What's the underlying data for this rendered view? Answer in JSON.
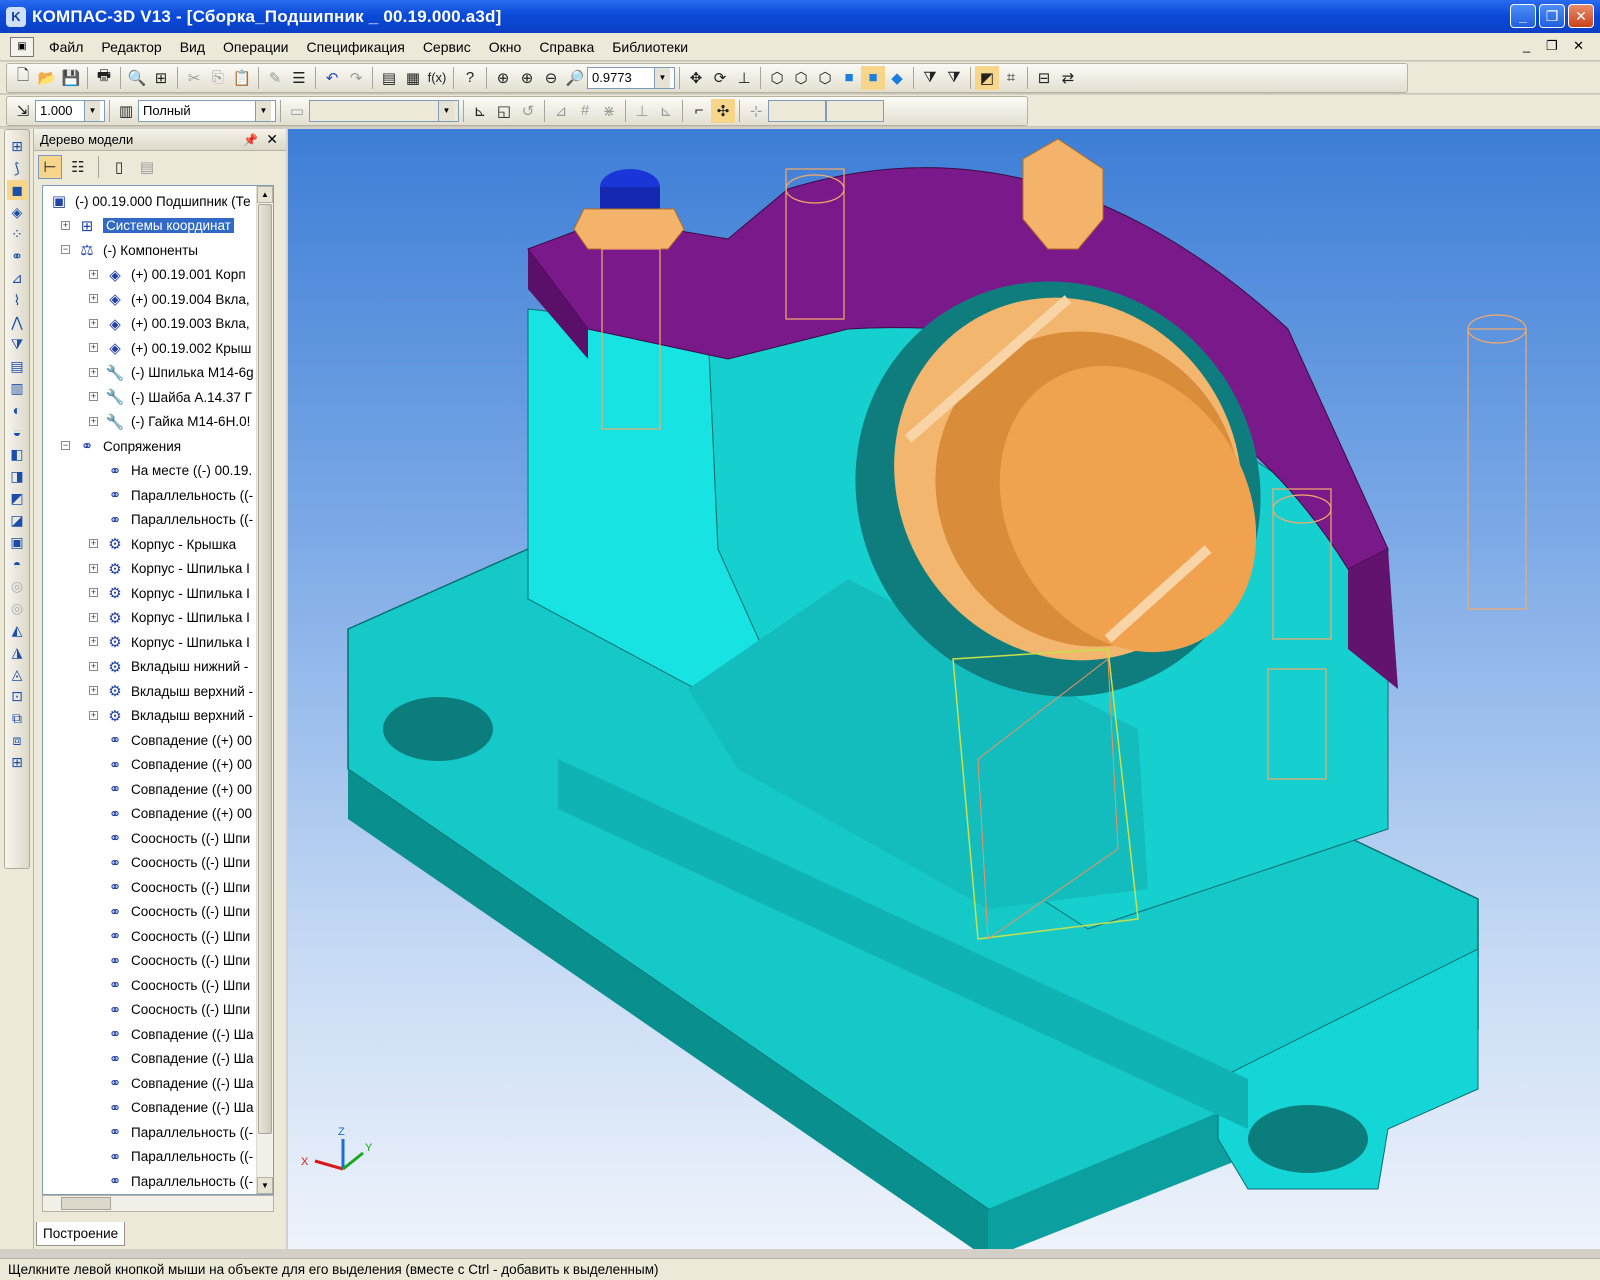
{
  "window": {
    "title": "КОМПАС-3D V13 - [Сборка_Подшипник _ 00.19.000.a3d]",
    "buttons": [
      "_",
      "❐",
      "✕"
    ]
  },
  "menu": [
    "Файл",
    "Редактор",
    "Вид",
    "Операции",
    "Спецификация",
    "Сервис",
    "Окно",
    "Справка",
    "Библиотеки"
  ],
  "mdi_controls": "_ ❐ ✕",
  "toolbar": {
    "zoom_value": "0.9773",
    "step_value": "1.000",
    "mode_value": "Полный"
  },
  "tree_panel": {
    "title": "Дерево модели",
    "tab": "Построение",
    "nodes": [
      "(-) 00.19.000 Подшипник (Те",
      "Системы координат",
      "(-) Компоненты",
      "(+) 00.19.001 Корп",
      "(+) 00.19.004 Вкла,",
      "(+) 00.19.003 Вкла,",
      "(+) 00.19.002 Крыш",
      "(-) Шпилька М14-6g",
      "(-) Шайба А.14.37 Г",
      "(-) Гайка М14-6Н.0!",
      "Сопряжения",
      "На месте ((-) 00.19.",
      "Параллельность ((-",
      "Параллельность ((-",
      "Корпус - Крышка",
      "Корпус - Шпилька I",
      "Корпус - Шпилька I",
      "Корпус - Шпилька I",
      "Корпус - Шпилька I",
      "Вкладыш нижний -",
      "Вкладыш верхний -",
      "Вкладыш верхний -",
      "Совпадение ((+) 00",
      "Совпадение ((+) 00",
      "Совпадение ((+) 00",
      "Совпадение ((+) 00",
      "Соосность ((-) Шпи",
      "Соосность ((-) Шпи",
      "Соосность ((-) Шпи",
      "Соосность ((-) Шпи",
      "Соосность ((-) Шпи",
      "Соосность ((-) Шпи",
      "Соосность ((-) Шпи",
      "Соосность ((-) Шпи",
      "Совпадение ((-) Ша",
      "Совпадение ((-) Ша",
      "Совпадение ((-) Ша",
      "Совпадение ((-) Ша",
      "Параллельность ((-",
      "Параллельность ((-",
      "Параллельность ((-"
    ]
  },
  "axes": {
    "x": "X",
    "y": "Y",
    "z": "Z"
  },
  "status_text": "Щелкните левой кнопкой мыши на объекте для его выделения (вместе с Ctrl - добавить к выделенным)",
  "colors": {
    "body": "#19e6e6",
    "cover": "#7a1a8a",
    "bushing": "#f4b36a",
    "background_top": "#3d7ed6"
  }
}
